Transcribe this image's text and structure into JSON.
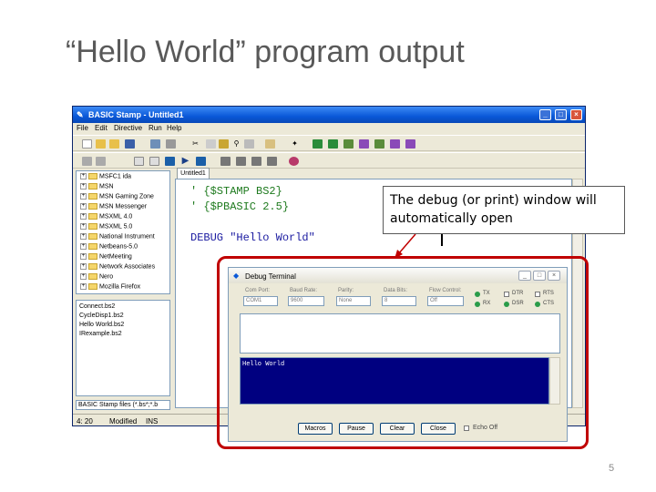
{
  "slide": {
    "title": "“Hello World” program output",
    "page_number": "5"
  },
  "ide": {
    "title": "BASIC Stamp - Untitled1",
    "menu": [
      "File",
      "Edit",
      "Directive",
      "Run",
      "Help"
    ],
    "tree_items": [
      "MSFC1 ida",
      "MSN",
      "MSN Gaming Zone",
      "MSN Messenger",
      "MSXML 4.0",
      "MSXML 5.0",
      "National Instrument",
      "Netbeans-5.0",
      "NetMeeting",
      "Network Associates",
      "Nero",
      "Mozilla Firefox"
    ],
    "files": [
      "Connect.bs2",
      "CycleDisp1.bs2",
      "Hello World.bs2",
      "IRexample.bs2"
    ],
    "file_filter": "BASIC Stamp files (*.bs*;*.b",
    "editor_tab": "Untitled1",
    "code": [
      "' {$STAMP BS2}",
      "' {$PBASIC 2.5}",
      "",
      "DEBUG \"Hello World\""
    ],
    "status": {
      "position": "4: 20",
      "modified": "Modified",
      "mode": "INS"
    }
  },
  "callout": {
    "text": "The debug (or print) window will automatically open"
  },
  "debug_terminal": {
    "title": "Debug Terminal",
    "settings": [
      {
        "label": "Com Port:",
        "value": "COM1"
      },
      {
        "label": "Baud Rate:",
        "value": "9600"
      },
      {
        "label": "Parity:",
        "value": "None"
      },
      {
        "label": "Data Bits:",
        "value": "8"
      },
      {
        "label": "Flow Control:",
        "value": "Off"
      }
    ],
    "indicators": [
      "TX",
      "RX",
      "DTR",
      "DSR",
      "RTS",
      "CTS"
    ],
    "output": "Hello World",
    "buttons": [
      "Macros",
      "Pause",
      "Clear",
      "Close"
    ],
    "echo_off": "Echo Off"
  }
}
